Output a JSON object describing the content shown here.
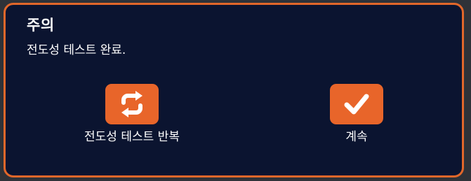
{
  "dialog": {
    "title": "주의",
    "message": "전도성 테스트 완료.",
    "accent_color": "#e8652a",
    "background_color": "#0b1430"
  },
  "actions": [
    {
      "label": "전도성 테스트 반복",
      "icon": "repeat-icon"
    },
    {
      "label": "계속",
      "icon": "checkmark-icon"
    }
  ]
}
